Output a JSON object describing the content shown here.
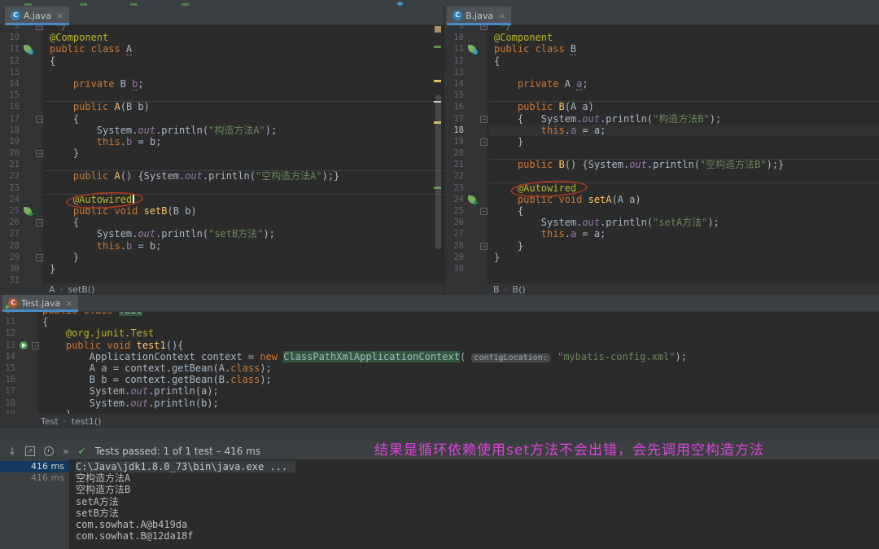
{
  "colors": {
    "editor_bg": "#2b2b2b",
    "gutter_bg": "#313335",
    "tab_underline": "#4a88c7",
    "keyword": "#cc7832",
    "annotation_token": "#bbb529",
    "string": "#6a8759",
    "field": "#9876aa",
    "method": "#ffc66d",
    "annotation_overlay": "#d944d9",
    "passed_green": "#56a156",
    "red_circle": "#9c3a21"
  },
  "panes": {
    "a": {
      "tab": "A.java",
      "breadcrumb": [
        "A",
        "setB()"
      ],
      "lines": [
        {
          "n": 9,
          "tk": [
            [
              " */",
              "cmt"
            ]
          ],
          "fold": 1
        },
        {
          "n": 10,
          "tk": [
            [
              "@Component",
              "ann"
            ]
          ]
        },
        {
          "n": 11,
          "tk": [
            [
              "public class ",
              "kw"
            ],
            [
              "A",
              "def ul"
            ]
          ],
          "icon": "spring"
        },
        {
          "n": 12,
          "tk": [
            [
              "{",
              "def"
            ]
          ]
        },
        {
          "n": 13,
          "tk": []
        },
        {
          "n": 14,
          "tk": [
            [
              "    ",
              "def"
            ],
            [
              "private ",
              "kw"
            ],
            [
              "B ",
              "def"
            ],
            [
              "b",
              "fld ul"
            ],
            [
              ";",
              "def"
            ]
          ]
        },
        {
          "n": 15,
          "tk": []
        },
        {
          "n": 16,
          "tk": [
            [
              "    ",
              "def"
            ],
            [
              "public ",
              "kw"
            ],
            [
              "A",
              "mth"
            ],
            [
              "(B b)",
              "def"
            ]
          ],
          "sep": 1
        },
        {
          "n": 17,
          "tk": [
            [
              "    {",
              "def"
            ]
          ],
          "fold": 1
        },
        {
          "n": 18,
          "tk": [
            [
              "        System.",
              "def"
            ],
            [
              "out",
              "fldi"
            ],
            [
              ".println(",
              "def"
            ],
            [
              "\"构造方法A\"",
              "str"
            ],
            [
              ");",
              "def"
            ]
          ]
        },
        {
          "n": 19,
          "tk": [
            [
              "        ",
              "def"
            ],
            [
              "this",
              "kw"
            ],
            [
              ".",
              "def"
            ],
            [
              "b",
              "fld"
            ],
            [
              " = b;",
              "def"
            ]
          ]
        },
        {
          "n": 20,
          "tk": [
            [
              "    }",
              "def"
            ]
          ],
          "fold": 1
        },
        {
          "n": 21,
          "tk": []
        },
        {
          "n": 22,
          "tk": [
            [
              "    ",
              "def"
            ],
            [
              "public ",
              "kw"
            ],
            [
              "A",
              "mth"
            ],
            [
              "() {System.",
              "def"
            ],
            [
              "out",
              "fldi"
            ],
            [
              ".println(",
              "def"
            ],
            [
              "\"空构造方法A\"",
              "str"
            ],
            [
              ");}",
              "def"
            ]
          ],
          "sep": 1
        },
        {
          "n": 23,
          "tk": []
        },
        {
          "n": 24,
          "tk": [
            [
              "    ",
              "def"
            ],
            [
              "@Autowired",
              "ann circ"
            ]
          ],
          "sep": 1,
          "caret": 1
        },
        {
          "n": 25,
          "tk": [
            [
              "    ",
              "def"
            ],
            [
              "public ",
              "kw"
            ],
            [
              "void ",
              "kw"
            ],
            [
              "setB",
              "mth"
            ],
            [
              "(B b)",
              "def"
            ]
          ],
          "icon": "spring2"
        },
        {
          "n": 26,
          "tk": [
            [
              "    {",
              "def"
            ]
          ],
          "fold": 1
        },
        {
          "n": 27,
          "tk": [
            [
              "        System.",
              "def"
            ],
            [
              "out",
              "fldi"
            ],
            [
              ".println(",
              "def"
            ],
            [
              "\"setB方法\"",
              "str"
            ],
            [
              ");",
              "def"
            ]
          ]
        },
        {
          "n": 28,
          "tk": [
            [
              "        ",
              "def"
            ],
            [
              "this",
              "kw"
            ],
            [
              ".",
              "def"
            ],
            [
              "b",
              "fld"
            ],
            [
              " = b;",
              "def"
            ]
          ]
        },
        {
          "n": 29,
          "tk": [
            [
              "    }",
              "def"
            ]
          ],
          "fold": 1
        },
        {
          "n": 30,
          "tk": [
            [
              "}",
              "def"
            ]
          ]
        },
        {
          "n": 31,
          "tk": []
        }
      ]
    },
    "b": {
      "tab": "B.java",
      "breadcrumb": [
        "B",
        "B()"
      ],
      "lines": [
        {
          "n": 9,
          "tk": [
            [
              " */",
              "cmt"
            ]
          ],
          "fold": 1
        },
        {
          "n": 10,
          "tk": [
            [
              "@Component",
              "ann"
            ]
          ]
        },
        {
          "n": 11,
          "tk": [
            [
              "public class ",
              "kw"
            ],
            [
              "B",
              "def ul"
            ]
          ],
          "icon": "spring"
        },
        {
          "n": 12,
          "tk": [
            [
              "{",
              "def"
            ]
          ]
        },
        {
          "n": 13,
          "tk": []
        },
        {
          "n": 14,
          "tk": [
            [
              "    ",
              "def"
            ],
            [
              "private ",
              "kw"
            ],
            [
              "A ",
              "def"
            ],
            [
              "a",
              "fld ul"
            ],
            [
              ";",
              "def"
            ]
          ]
        },
        {
          "n": 15,
          "tk": []
        },
        {
          "n": 16,
          "tk": [
            [
              "    ",
              "def"
            ],
            [
              "public ",
              "kw"
            ],
            [
              "B",
              "mth"
            ],
            [
              "(A a)",
              "def"
            ]
          ],
          "sep": 1
        },
        {
          "n": 17,
          "tk": [
            [
              "    {   System.",
              "def"
            ],
            [
              "out",
              "fldi"
            ],
            [
              ".println(",
              "def"
            ],
            [
              "\"构造方法B\"",
              "str"
            ],
            [
              ");",
              "def"
            ]
          ],
          "fold": 1
        },
        {
          "n": 18,
          "tk": [
            [
              "        ",
              "def"
            ],
            [
              "this",
              "kw"
            ],
            [
              ".",
              "def"
            ],
            [
              "a",
              "fld"
            ],
            [
              " = a;",
              "def"
            ]
          ],
          "cur": 1
        },
        {
          "n": 19,
          "tk": [
            [
              "    }",
              "def"
            ]
          ],
          "fold": 1
        },
        {
          "n": 20,
          "tk": []
        },
        {
          "n": 21,
          "tk": [
            [
              "    ",
              "def"
            ],
            [
              "public ",
              "kw"
            ],
            [
              "B",
              "mth"
            ],
            [
              "() {System.",
              "def"
            ],
            [
              "out",
              "fldi"
            ],
            [
              ".println(",
              "def"
            ],
            [
              "\"空构造方法B\"",
              "str"
            ],
            [
              ");}",
              "def"
            ]
          ],
          "sep": 1
        },
        {
          "n": 22,
          "tk": []
        },
        {
          "n": 23,
          "tk": [
            [
              "    ",
              "def"
            ],
            [
              "@Autowired",
              "ann circ"
            ]
          ],
          "sep": 1
        },
        {
          "n": 24,
          "tk": [
            [
              "    ",
              "def"
            ],
            [
              "public ",
              "kw"
            ],
            [
              "void ",
              "kw"
            ],
            [
              "setA",
              "mth"
            ],
            [
              "(A a)",
              "def"
            ]
          ],
          "icon": "spring2"
        },
        {
          "n": 25,
          "tk": [
            [
              "    {",
              "def"
            ]
          ],
          "fold": 1
        },
        {
          "n": 26,
          "tk": [
            [
              "        System.",
              "def"
            ],
            [
              "out",
              "fldi"
            ],
            [
              ".println(",
              "def"
            ],
            [
              "\"setA方法\"",
              "str"
            ],
            [
              ");",
              "def"
            ]
          ]
        },
        {
          "n": 27,
          "tk": [
            [
              "        ",
              "def"
            ],
            [
              "this",
              "kw"
            ],
            [
              ".",
              "def"
            ],
            [
              "a",
              "fld"
            ],
            [
              " = a;",
              "def"
            ]
          ]
        },
        {
          "n": 28,
          "tk": [
            [
              "    }",
              "def"
            ]
          ],
          "fold": 1
        },
        {
          "n": 29,
          "tk": [
            [
              "}",
              "def"
            ]
          ]
        },
        {
          "n": 30,
          "tk": []
        }
      ]
    },
    "test": {
      "tab": "Test.java",
      "breadcrumb": [
        "Test",
        "test1()"
      ],
      "lines": [
        {
          "n": 10,
          "tk": [
            [
              "public class ",
              "kw"
            ],
            [
              "Test",
              "def hl"
            ]
          ]
        },
        {
          "n": 11,
          "tk": [
            [
              "{",
              "def"
            ]
          ]
        },
        {
          "n": 12,
          "tk": [
            [
              "    ",
              "def"
            ],
            [
              "@org.junit.Test",
              "ann"
            ]
          ]
        },
        {
          "n": 13,
          "tk": [
            [
              "    ",
              "def"
            ],
            [
              "public ",
              "kw"
            ],
            [
              "void ",
              "kw"
            ],
            [
              "test1",
              "mth"
            ],
            [
              "(){",
              "def"
            ]
          ],
          "icon": "run",
          "fold": 1
        },
        {
          "n": 14,
          "tk": [
            [
              "        ApplicationContext context = ",
              "def"
            ],
            [
              "new ",
              "kw"
            ],
            [
              "ClassPathXmlApplicationContext",
              "def hl"
            ],
            [
              "( ",
              "def"
            ],
            [
              "configLocation:",
              "hint"
            ],
            [
              " ",
              "def"
            ],
            [
              "\"mybatis-config.xml\"",
              "str"
            ],
            [
              ");",
              "def"
            ]
          ]
        },
        {
          "n": 15,
          "tk": [
            [
              "        A a = context.getBean(A.",
              "def"
            ],
            [
              "class",
              "kw"
            ],
            [
              ");",
              "def"
            ]
          ]
        },
        {
          "n": 16,
          "tk": [
            [
              "        B b = context.getBean(B.",
              "def"
            ],
            [
              "class",
              "kw"
            ],
            [
              ");",
              "def"
            ]
          ]
        },
        {
          "n": 17,
          "tk": [
            [
              "        System.",
              "def"
            ],
            [
              "out",
              "fldi"
            ],
            [
              ".println(a);",
              "def"
            ]
          ]
        },
        {
          "n": 18,
          "tk": [
            [
              "        System.",
              "def"
            ],
            [
              "out",
              "fldi"
            ],
            [
              ".println(b);",
              "def"
            ]
          ]
        },
        {
          "n": 19,
          "tk": [
            [
              "    }",
              "def"
            ]
          ]
        }
      ]
    }
  },
  "runner": {
    "icons": [
      "scroll-down-icon",
      "export-test-results-icon",
      "test-history-icon",
      "more-icon",
      "passed-check-icon"
    ],
    "status": "Tests passed: 1 of 1 test – 416 ms",
    "tree": [
      {
        "duration": "416 ms",
        "selected": true
      },
      {
        "duration": "416 ms",
        "selected": false
      }
    ],
    "console": [
      "C:\\Java\\jdk1.8.0_73\\bin\\java.exe ...",
      "空构造方法A",
      "空构造方法B",
      "setA方法",
      "setB方法",
      "com.sowhat.A@b419da",
      "com.sowhat.B@12da18f"
    ]
  },
  "annotation": "结果是循环依赖使用set方法不会出错，会先调用空构造方法"
}
